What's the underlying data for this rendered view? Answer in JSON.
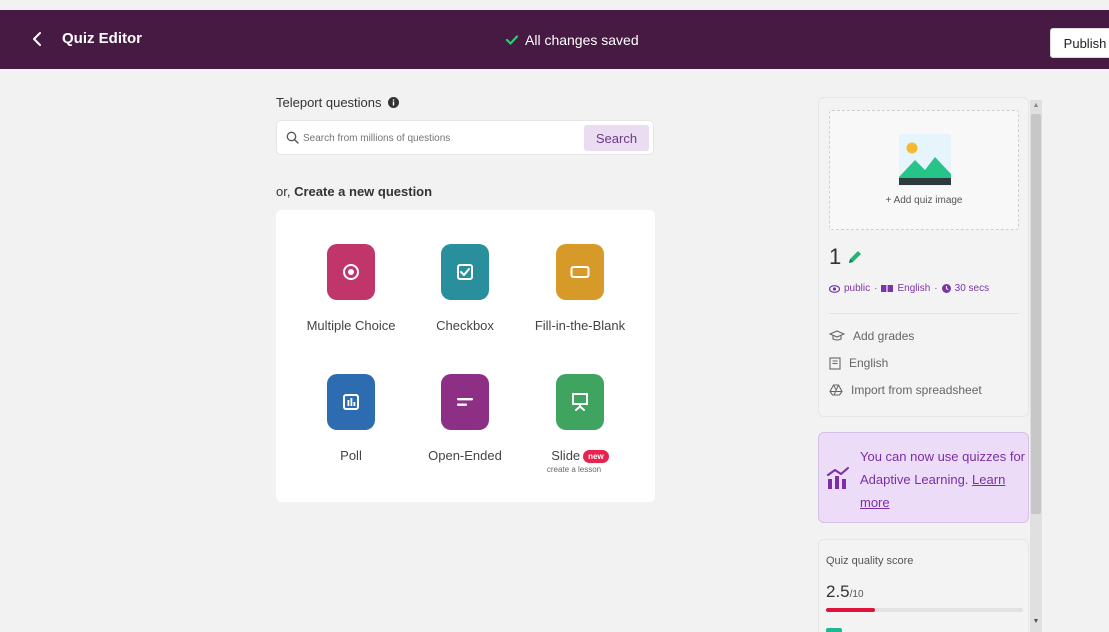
{
  "header": {
    "title": "Quiz Editor",
    "status": "All changes saved",
    "publish_label": "Publish"
  },
  "teleport": {
    "label": "Teleport questions",
    "placeholder": "Search from millions of questions",
    "search_label": "Search"
  },
  "create": {
    "prefix": "or, ",
    "label": "Create a new question",
    "types": [
      {
        "label": "Multiple Choice",
        "icon": "multiple-choice-icon",
        "color": "#c0356a"
      },
      {
        "label": "Checkbox",
        "icon": "checkbox-icon",
        "color": "#2a8f9c"
      },
      {
        "label": "Fill-in-the-Blank",
        "icon": "fill-blank-icon",
        "color": "#d79a28"
      },
      {
        "label": "Poll",
        "icon": "poll-icon",
        "color": "#2d6cb0"
      },
      {
        "label": "Open-Ended",
        "icon": "open-ended-icon",
        "color": "#8d2f85"
      },
      {
        "label": "Slide",
        "icon": "slide-icon",
        "color": "#3ea45f",
        "badge": "new",
        "note": "create a lesson"
      }
    ]
  },
  "quiz": {
    "add_image_label": "+ Add quiz image",
    "name": "1",
    "visibility": "public",
    "language_tag": "English",
    "time": "30 secs",
    "options": [
      "Add grades",
      "English",
      "Import from spreadsheet"
    ]
  },
  "promo": {
    "text": "You can now use quizzes for Adaptive Learning.",
    "link": "Learn more"
  },
  "quality": {
    "label": "Quiz quality score",
    "score": "2.5",
    "max": "/10",
    "fraction": 0.25
  },
  "colors": {
    "header_bg": "#461a42",
    "accent": "#7a35a8",
    "score_bar": "#e0133b",
    "saved_check": "#2ecc71"
  }
}
